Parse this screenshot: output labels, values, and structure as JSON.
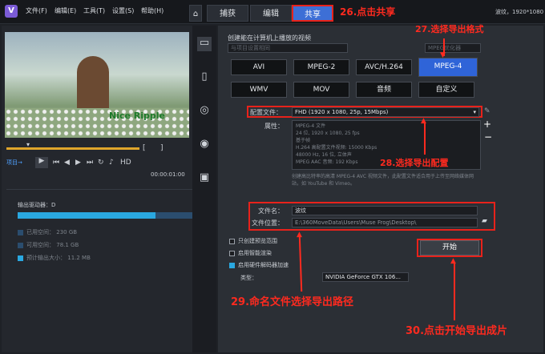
{
  "app": {
    "logo": "V",
    "resolution": "波纹，1920*1080"
  },
  "menu": [
    "文件(F)",
    "编辑(E)",
    "工具(T)",
    "设置(S)",
    "帮助(H)"
  ],
  "tabs": [
    "捕获",
    "编辑",
    "共享"
  ],
  "annotations": {
    "a26": "26.点击共享",
    "a27": "27.选择导出格式",
    "a28": "28.选择导出配置",
    "a29": "29.命名文件选择导出路径",
    "a30": "30.点击开始导出成片"
  },
  "preview": {
    "watermark": "Nice Ripple",
    "project_label": "项目→",
    "timecode": "00:00:01:00",
    "hd": "HD"
  },
  "disk": {
    "drive": "输出驱动器：D",
    "rows": [
      {
        "label": "已用空间：",
        "value": "230 GB",
        "color": "#2b4d6e"
      },
      {
        "label": "可用空间：",
        "value": "78.1 GB",
        "color": "#2b4d6e"
      },
      {
        "label": "预计输出大小：",
        "value": "11.2 MB",
        "color": "#2aa8e0"
      }
    ],
    "used_fraction": 0.74
  },
  "share": {
    "header": "创建能在计算机上播放的视频",
    "disabled_option": "与项目设置相同",
    "disabled_option_right": "MPEG优化器",
    "formats_row1": [
      "AVI",
      "MPEG-2",
      "AVC/H.264",
      "MPEG-4"
    ],
    "formats_row2": [
      "WMV",
      "MOV",
      "音频",
      "自定义"
    ],
    "profile_label": "配置文件：",
    "profile_value": "FHD (1920 x 1080, 25p, 15Mbps)",
    "props_label": "属性：",
    "props": [
      "MPEG-4 文件",
      "24 位, 1920 x 1080, 25 fps",
      "基于帧",
      "H.264 高配置文件视频: 15000 Kbps",
      "48000 Hz, 16 位, 立体声",
      "MPEG AAC 音频: 192 Kbps"
    ],
    "desc": "创建高比特率的高清 MPEG-4 AVC 视频文件，此配置文件适合用于上传至网络媒体网站，如 YouTube 和 Vimeo。",
    "filename_label": "文件名：",
    "filename_value": "波纹",
    "location_label": "文件位置：",
    "location_value": "E:\\360MoveData\\Users\\Muse Frog\\Desktop\\",
    "checks": [
      "只创建预览范围",
      "启用智能渲染",
      "启用硬件解码器加速"
    ],
    "type_label": "类型：",
    "type_value": "NVIDIA GeForce GTX 106...",
    "start": "开始"
  }
}
